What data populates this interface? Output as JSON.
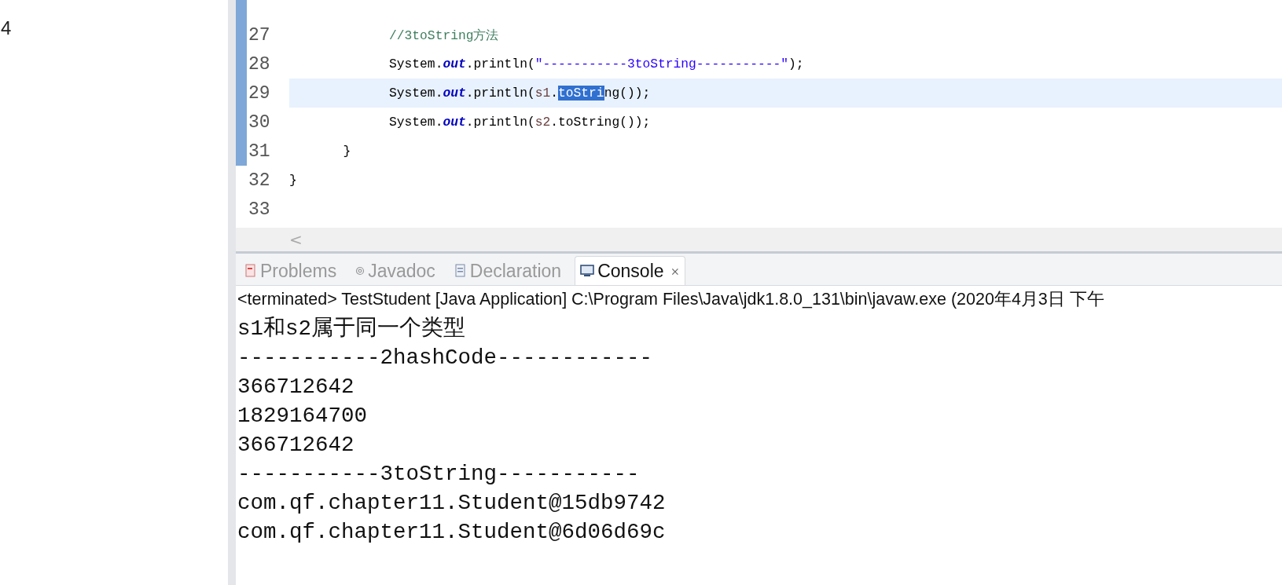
{
  "left_pane": {
    "lines": [
      "4"
    ]
  },
  "editor": {
    "lines": [
      {
        "number": "27",
        "segments": [
          {
            "kind": "comment",
            "text": "             //3toString方法"
          }
        ]
      },
      {
        "number": "28",
        "segments": [
          {
            "kind": "plain",
            "text": "             System."
          },
          {
            "kind": "field",
            "text": "out"
          },
          {
            "kind": "plain",
            "text": ".println("
          },
          {
            "kind": "string",
            "text": "\"-----------3toString-----------\""
          },
          {
            "kind": "plain",
            "text": ");"
          }
        ]
      },
      {
        "number": "29",
        "current": true,
        "segments": [
          {
            "kind": "plain",
            "text": "             System."
          },
          {
            "kind": "field",
            "text": "out"
          },
          {
            "kind": "plain",
            "text": ".println("
          },
          {
            "kind": "variable",
            "text": "s1"
          },
          {
            "kind": "plain",
            "text": "."
          },
          {
            "kind": "selection",
            "text": "toStri"
          },
          {
            "kind": "plain",
            "text": "ng());"
          }
        ]
      },
      {
        "number": "30",
        "segments": [
          {
            "kind": "plain",
            "text": "             System."
          },
          {
            "kind": "field",
            "text": "out"
          },
          {
            "kind": "plain",
            "text": ".println("
          },
          {
            "kind": "variable",
            "text": "s2"
          },
          {
            "kind": "plain",
            "text": ".toString());"
          }
        ]
      },
      {
        "number": "31",
        "segments": [
          {
            "kind": "plain",
            "text": "       }"
          }
        ]
      },
      {
        "number": "32",
        "segments": [
          {
            "kind": "plain",
            "text": "}"
          }
        ]
      },
      {
        "number": "33"
      }
    ],
    "scroll_left": "<"
  },
  "tabs": [
    {
      "label": "Problems",
      "selected": false
    },
    {
      "label": "Javadoc",
      "selected": false
    },
    {
      "label": "Declaration",
      "selected": false
    },
    {
      "label": "Console",
      "selected": true,
      "close": "⨯"
    }
  ],
  "console": {
    "header": "<terminated> TestStudent [Java Application] C:\\Program Files\\Java\\jdk1.8.0_131\\bin\\javaw.exe (2020年4月3日 下午",
    "lines": [
      "s1和s2属于同一个类型",
      "-----------2hashCode------------",
      "366712642",
      "1829164700",
      "366712642",
      "-----------3toString-----------",
      "com.qf.chapter11.Student@15db9742",
      "com.qf.chapter11.Student@6d06d69c"
    ]
  }
}
